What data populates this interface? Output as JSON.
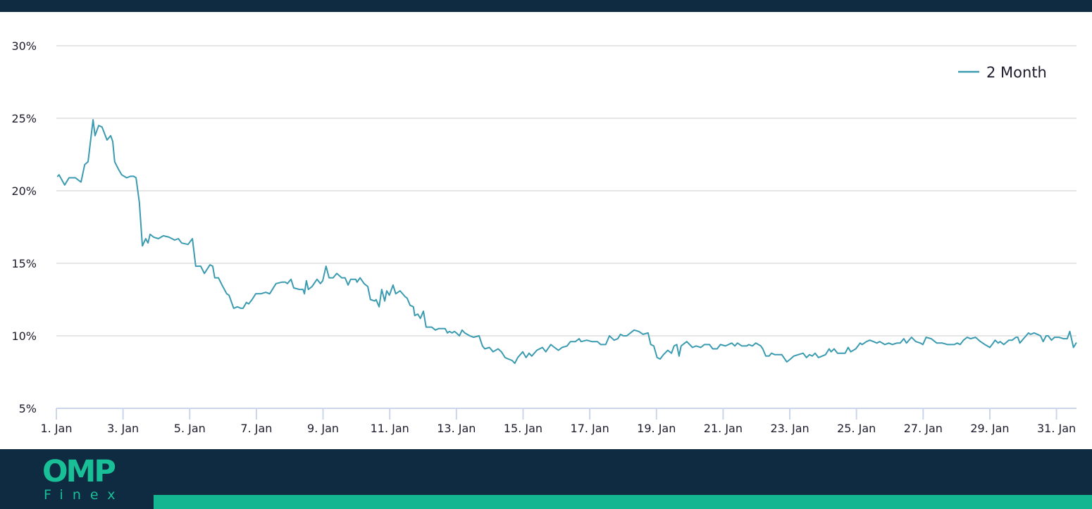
{
  "colors": {
    "header_bg": "#0e2b41",
    "footer_bg": "#0e2b41",
    "brand_teal": "#19bf97",
    "accent_bar": "#13b691",
    "series_line": "#3b9bb0",
    "grid": "#e6e6e6",
    "axis": "#ccd6eb"
  },
  "footer": {
    "logo": {
      "main": "OMP",
      "sub": "Finex"
    }
  },
  "chart_data": {
    "type": "line",
    "title": "",
    "xlabel": "",
    "ylabel": "",
    "xlim": [
      1,
      31.6
    ],
    "ylim": [
      5,
      30
    ],
    "grid": true,
    "legend_position": "top-right",
    "y_ticks": [
      {
        "value": 5,
        "label": "5%"
      },
      {
        "value": 10,
        "label": "10%"
      },
      {
        "value": 15,
        "label": "15%"
      },
      {
        "value": 20,
        "label": "20%"
      },
      {
        "value": 25,
        "label": "25%"
      },
      {
        "value": 30,
        "label": "30%"
      }
    ],
    "x_ticks": [
      {
        "value": 1,
        "label": "1. Jan"
      },
      {
        "value": 3,
        "label": "3. Jan"
      },
      {
        "value": 5,
        "label": "5. Jan"
      },
      {
        "value": 7,
        "label": "7. Jan"
      },
      {
        "value": 9,
        "label": "9. Jan"
      },
      {
        "value": 11,
        "label": "11. Jan"
      },
      {
        "value": 13,
        "label": "13. Jan"
      },
      {
        "value": 15,
        "label": "15. Jan"
      },
      {
        "value": 17,
        "label": "17. Jan"
      },
      {
        "value": 19,
        "label": "19. Jan"
      },
      {
        "value": 21,
        "label": "21. Jan"
      },
      {
        "value": 23,
        "label": "23. Jan"
      },
      {
        "value": 25,
        "label": "25. Jan"
      },
      {
        "value": 27,
        "label": "27. Jan"
      },
      {
        "value": 29,
        "label": "29. Jan"
      },
      {
        "value": 31,
        "label": "31. Jan"
      }
    ],
    "series": [
      {
        "name": "2 Month",
        "color": "#3b9bb0",
        "x_unit": "day of January",
        "y_unit": "%",
        "x": [
          1.04,
          1.08,
          1.25,
          1.38,
          1.57,
          1.68,
          1.74,
          1.85,
          1.95,
          2.1,
          2.16,
          2.27,
          2.37,
          2.52,
          2.63,
          2.69,
          2.75,
          2.86,
          2.96,
          3.11,
          3.22,
          3.32,
          3.39,
          3.49,
          3.58,
          3.68,
          3.75,
          3.81,
          3.92,
          4.06,
          4.21,
          4.38,
          4.55,
          4.66,
          4.76,
          4.95,
          5.08,
          5.18,
          5.33,
          5.44,
          5.61,
          5.69,
          5.75,
          5.86,
          5.97,
          6.11,
          6.18,
          6.32,
          6.43,
          6.54,
          6.6,
          6.7,
          6.77,
          6.87,
          6.98,
          7.13,
          7.28,
          7.4,
          7.59,
          7.76,
          7.87,
          7.93,
          8.04,
          8.12,
          8.29,
          8.4,
          8.44,
          8.5,
          8.56,
          8.67,
          8.82,
          8.92,
          8.99,
          9.09,
          9.18,
          9.3,
          9.41,
          9.56,
          9.66,
          9.75,
          9.83,
          9.98,
          10.02,
          10.11,
          10.23,
          10.34,
          10.42,
          10.55,
          10.59,
          10.68,
          10.76,
          10.85,
          10.91,
          10.99,
          11.1,
          11.18,
          11.31,
          11.46,
          11.52,
          11.61,
          11.71,
          11.75,
          11.84,
          11.92,
          12.01,
          12.09,
          12.2,
          12.26,
          12.37,
          12.47,
          12.66,
          12.73,
          12.79,
          12.87,
          12.94,
          13.0,
          13.09,
          13.17,
          13.25,
          13.4,
          13.51,
          13.68,
          13.78,
          13.85,
          13.99,
          14.1,
          14.25,
          14.35,
          14.46,
          14.56,
          14.67,
          14.75,
          14.84,
          14.99,
          15.09,
          15.18,
          15.26,
          15.41,
          15.58,
          15.68,
          15.83,
          15.94,
          16.06,
          16.17,
          16.32,
          16.42,
          16.57,
          16.68,
          16.74,
          16.91,
          17.06,
          17.23,
          17.33,
          17.48,
          17.59,
          17.73,
          17.84,
          17.92,
          18.01,
          18.11,
          18.33,
          18.47,
          18.6,
          18.75,
          18.83,
          18.92,
          19.02,
          19.11,
          19.21,
          19.34,
          19.45,
          19.53,
          19.61,
          19.68,
          19.74,
          19.85,
          19.91,
          20.08,
          20.19,
          20.33,
          20.44,
          20.59,
          20.69,
          20.82,
          20.92,
          21.07,
          21.26,
          21.35,
          21.43,
          21.56,
          21.71,
          21.77,
          21.88,
          21.98,
          22.13,
          22.19,
          22.28,
          22.38,
          22.45,
          22.55,
          22.7,
          22.76,
          22.91,
          23.02,
          23.12,
          23.25,
          23.4,
          23.5,
          23.59,
          23.67,
          23.76,
          23.86,
          23.97,
          24.07,
          24.18,
          24.24,
          24.33,
          24.43,
          24.56,
          24.66,
          24.75,
          24.83,
          24.98,
          25.11,
          25.17,
          25.3,
          25.4,
          25.51,
          25.61,
          25.7,
          25.85,
          25.97,
          26.08,
          26.21,
          26.31,
          26.42,
          26.5,
          26.65,
          26.78,
          26.92,
          26.99,
          27.09,
          27.24,
          27.41,
          27.58,
          27.73,
          27.83,
          27.94,
          28.02,
          28.11,
          28.21,
          28.32,
          28.42,
          28.57,
          28.72,
          28.85,
          29.0,
          29.1,
          29.16,
          29.25,
          29.31,
          29.42,
          29.57,
          29.67,
          29.78,
          29.84,
          29.9,
          30.01,
          30.16,
          30.22,
          30.33,
          30.43,
          30.52,
          30.6,
          30.69,
          30.75,
          30.85,
          30.94,
          31.07,
          31.21,
          31.32,
          31.4,
          31.51,
          31.59
        ],
        "y": [
          21.0,
          21.1,
          20.4,
          20.9,
          20.9,
          20.7,
          20.6,
          21.8,
          22.0,
          24.9,
          23.8,
          24.5,
          24.4,
          23.5,
          23.8,
          23.4,
          22.0,
          21.5,
          21.1,
          20.9,
          21.0,
          21.0,
          20.9,
          19.2,
          16.2,
          16.7,
          16.4,
          17.0,
          16.8,
          16.7,
          16.9,
          16.8,
          16.6,
          16.7,
          16.4,
          16.3,
          16.7,
          14.8,
          14.8,
          14.3,
          14.9,
          14.8,
          14.0,
          14.0,
          13.5,
          12.9,
          12.8,
          11.9,
          12.0,
          11.9,
          11.9,
          12.3,
          12.2,
          12.5,
          12.9,
          12.9,
          13.0,
          12.9,
          13.6,
          13.7,
          13.7,
          13.6,
          13.9,
          13.3,
          13.2,
          13.2,
          12.9,
          13.8,
          13.2,
          13.4,
          13.9,
          13.6,
          13.8,
          14.8,
          14.0,
          14.0,
          14.3,
          14.0,
          14.0,
          13.5,
          13.9,
          13.9,
          13.7,
          14.0,
          13.6,
          13.4,
          12.5,
          12.4,
          12.5,
          12.0,
          13.2,
          12.4,
          13.1,
          12.8,
          13.5,
          12.9,
          13.1,
          12.7,
          12.6,
          12.1,
          12.0,
          11.4,
          11.5,
          11.2,
          11.7,
          10.6,
          10.6,
          10.6,
          10.4,
          10.5,
          10.5,
          10.2,
          10.3,
          10.2,
          10.3,
          10.2,
          10.0,
          10.4,
          10.2,
          10.0,
          9.9,
          10.0,
          9.3,
          9.1,
          9.2,
          8.9,
          9.1,
          8.9,
          8.5,
          8.4,
          8.3,
          8.1,
          8.5,
          8.9,
          8.5,
          8.8,
          8.6,
          9.0,
          9.2,
          8.9,
          9.4,
          9.2,
          9.0,
          9.2,
          9.3,
          9.6,
          9.6,
          9.8,
          9.6,
          9.7,
          9.6,
          9.6,
          9.4,
          9.4,
          10.0,
          9.7,
          9.8,
          10.1,
          10.0,
          10.0,
          10.4,
          10.3,
          10.1,
          10.2,
          9.4,
          9.3,
          8.5,
          8.4,
          8.7,
          9.0,
          8.8,
          9.3,
          9.4,
          8.6,
          9.3,
          9.5,
          9.6,
          9.2,
          9.3,
          9.2,
          9.4,
          9.4,
          9.1,
          9.1,
          9.4,
          9.3,
          9.5,
          9.3,
          9.5,
          9.3,
          9.3,
          9.4,
          9.3,
          9.5,
          9.3,
          9.1,
          8.6,
          8.6,
          8.8,
          8.7,
          8.7,
          8.7,
          8.2,
          8.4,
          8.6,
          8.7,
          8.8,
          8.5,
          8.7,
          8.6,
          8.8,
          8.5,
          8.6,
          8.7,
          9.1,
          8.9,
          9.1,
          8.8,
          8.8,
          8.8,
          9.2,
          8.9,
          9.1,
          9.5,
          9.4,
          9.6,
          9.7,
          9.6,
          9.5,
          9.6,
          9.4,
          9.5,
          9.4,
          9.5,
          9.5,
          9.8,
          9.5,
          9.9,
          9.6,
          9.5,
          9.4,
          9.9,
          9.8,
          9.5,
          9.5,
          9.4,
          9.4,
          9.4,
          9.5,
          9.4,
          9.7,
          9.9,
          9.8,
          9.9,
          9.6,
          9.4,
          9.2,
          9.5,
          9.7,
          9.5,
          9.6,
          9.4,
          9.7,
          9.7,
          9.9,
          9.9,
          9.5,
          9.8,
          10.2,
          10.1,
          10.2,
          10.1,
          10.0,
          9.6,
          10.0,
          10.0,
          9.7,
          9.9,
          9.9,
          9.8,
          9.8,
          10.3,
          9.2,
          9.5
        ]
      }
    ]
  }
}
